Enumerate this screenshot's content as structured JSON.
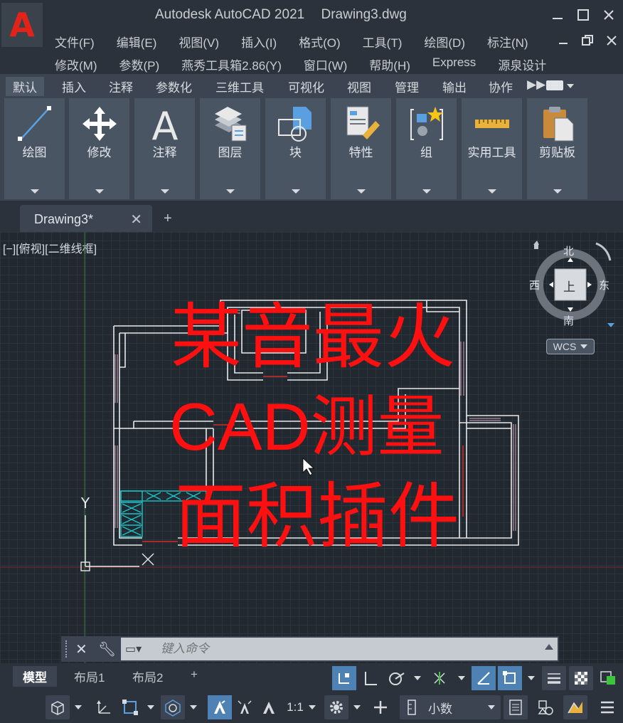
{
  "window": {
    "app_name": "Autodesk AutoCAD 2021",
    "file_name": "Drawing3.dwg",
    "logo_letter": "A"
  },
  "menu": {
    "row1": [
      "文件(F)",
      "编辑(E)",
      "视图(V)",
      "插入(I)",
      "格式(O)",
      "工具(T)",
      "绘图(D)",
      "标注(N)"
    ],
    "row2": [
      "修改(M)",
      "参数(P)",
      "燕秀工具箱2.86(Y)",
      "窗口(W)",
      "帮助(H)",
      "Express",
      "源泉设计"
    ]
  },
  "ribbon_tabs": [
    "默认",
    "插入",
    "注释",
    "参数化",
    "三维工具",
    "可视化",
    "视图",
    "管理",
    "输出",
    "协作"
  ],
  "ribbon_panels": [
    {
      "label": "绘图",
      "icon": "line-draw-icon"
    },
    {
      "label": "修改",
      "icon": "move-arrows-icon"
    },
    {
      "label": "注释",
      "icon": "text-a-icon"
    },
    {
      "label": "图层",
      "icon": "layers-icon"
    },
    {
      "label": "块",
      "icon": "block-icon"
    },
    {
      "label": "特性",
      "icon": "properties-icon"
    },
    {
      "label": "组",
      "icon": "group-icon"
    },
    {
      "label": "实用工具",
      "icon": "ruler-icon"
    },
    {
      "label": "剪贴板",
      "icon": "clipboard-icon"
    }
  ],
  "document_tab": {
    "name": "Drawing3*"
  },
  "viewport": {
    "label": "[−][俯视][二维线框]"
  },
  "overlay_text": {
    "line1": "某音最火",
    "line2": "CAD测量",
    "line3": "面积插件"
  },
  "viewcube": {
    "north": "北",
    "south": "南",
    "east": "东",
    "west": "西",
    "top_face": "上",
    "wcs": "WCS"
  },
  "ucs": {
    "y_label": "Y"
  },
  "command_line": {
    "placeholder": "键入命令"
  },
  "layout_tabs": [
    "模型",
    "布局1",
    "布局2"
  ],
  "status": {
    "scale": "1:1",
    "units": "小数"
  },
  "colors": {
    "accent_blue": "#4e82b4",
    "overlay_red": "#ff1010",
    "wall_white": "#e8e8e8",
    "cyan_block": "#19c3c9"
  }
}
